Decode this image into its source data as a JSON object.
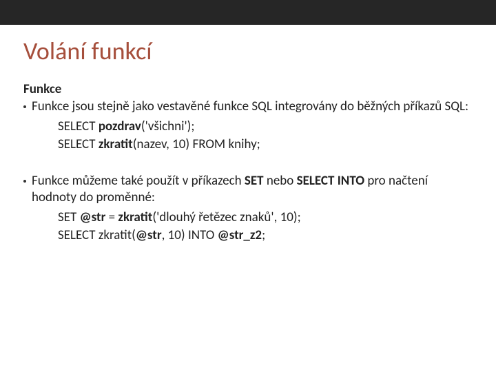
{
  "title": "Volání funkcí",
  "section1": {
    "heading": "Funkce",
    "bullet_text": "Funkce jsou stejně jako vestavěné funkce SQL integrovány do běžných příkazů SQL:",
    "code1_a": "SELECT ",
    "code1_b": "pozdrav",
    "code1_c": "('všichni');",
    "code2_a": "SELECT ",
    "code2_b": "zkratit",
    "code2_c": "(nazev, 10) FROM knihy;"
  },
  "section2": {
    "bullet_pre": "Funkce můžeme také použít v příkazech ",
    "bullet_kw1": "SET",
    "bullet_mid": " nebo ",
    "bullet_kw2": "SELECT INTO",
    "bullet_post": " pro načtení hodnoty do proměnné:",
    "code1_a": "SET ",
    "code1_b": "@str",
    "code1_c": " = ",
    "code1_d": "zkratit",
    "code1_e": "('dlouhý řetězec znaků', 10);",
    "code2_a": "SELECT zkratit(",
    "code2_b": "@str",
    "code2_c": ", 10) INTO ",
    "code2_d": "@str_z2",
    "code2_e": ";"
  }
}
